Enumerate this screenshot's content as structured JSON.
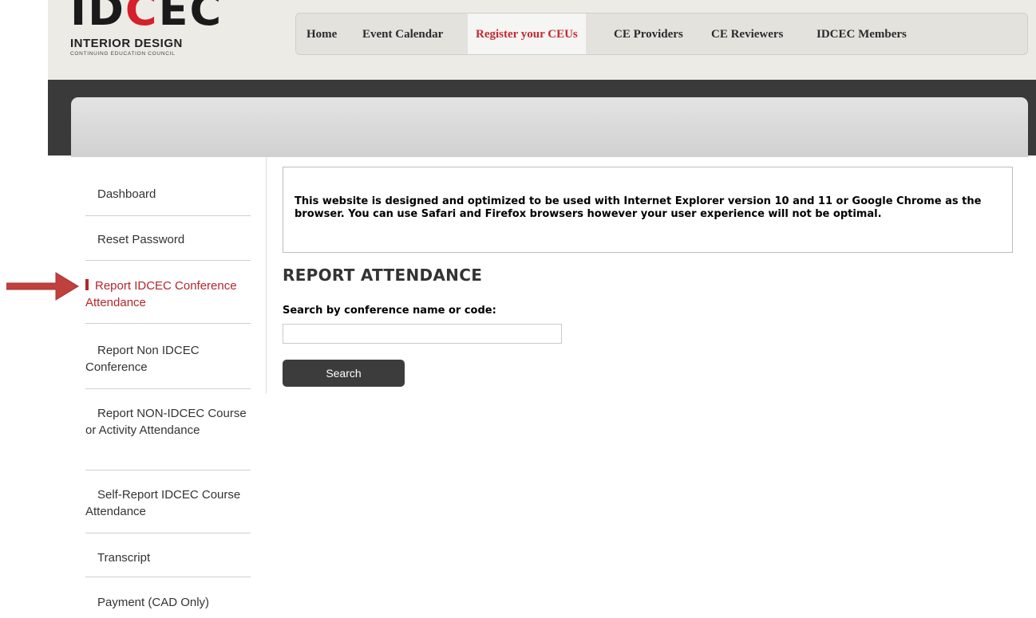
{
  "logo": {
    "mark_black_1": "ID",
    "mark_red": "C",
    "mark_black_2": "EC",
    "line1": "INTERIOR DESIGN",
    "line2": "CONTINUING EDUCATION COUNCIL"
  },
  "nav": {
    "items": [
      {
        "label": "Home"
      },
      {
        "label": "Event Calendar"
      },
      {
        "label": "Register your CEUs"
      },
      {
        "label": "CE Providers"
      },
      {
        "label": "CE Reviewers"
      },
      {
        "label": "IDCEC Members"
      }
    ],
    "active": "Register your CEUs",
    "active_color": "#c42a32"
  },
  "sidebar": {
    "items": [
      {
        "label": "Dashboard"
      },
      {
        "label": "Reset Password"
      },
      {
        "label": "Report IDCEC Conference Attendance"
      },
      {
        "label": "Report Non IDCEC Conference"
      },
      {
        "label": "Report NON-IDCEC Course or Activity Attendance"
      },
      {
        "label": "Self-Report IDCEC Course Attendance"
      },
      {
        "label": "Transcript"
      },
      {
        "label": "Payment (CAD Only)"
      }
    ],
    "active": "Report IDCEC Conference Attendance",
    "active_color": "#b3262b",
    "pointer_arrow_color": "#c0403e"
  },
  "main": {
    "notice": "This website is designed and optimized to be used with Internet Explorer version 10 and 11 or Google Chrome as the browser. You can use Safari and Firefox browsers however your user experience will not be optimal.",
    "title": "REPORT ATTENDANCE",
    "search_label": "Search by conference name or code:",
    "search_value": "",
    "search_button": "Search"
  }
}
